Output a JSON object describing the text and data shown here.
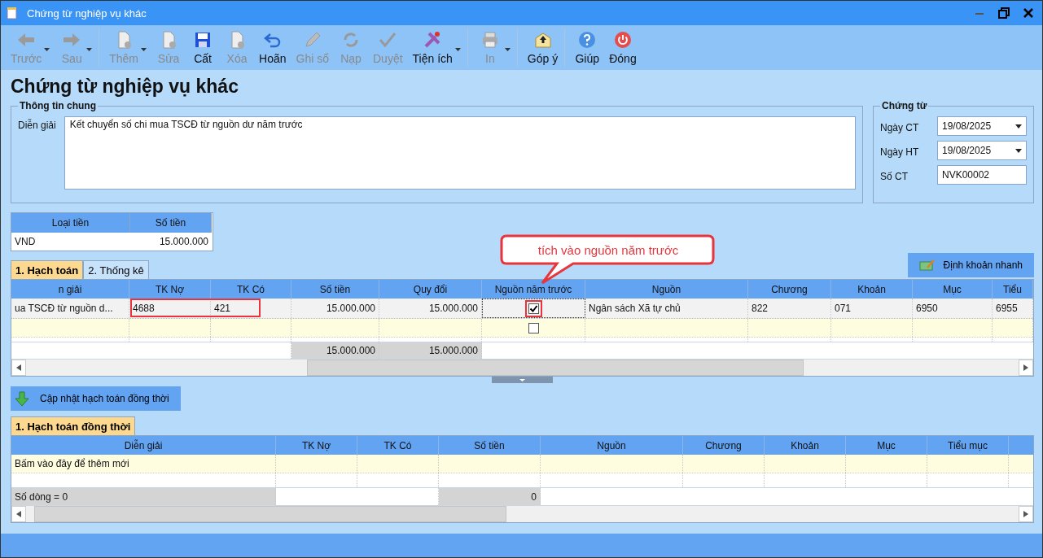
{
  "window": {
    "title": "Chứng từ nghiệp vụ khác"
  },
  "toolbar": [
    {
      "label": "Trước",
      "enabled": false,
      "dropdown": true,
      "sep_after": false
    },
    {
      "label": "Sau",
      "enabled": false,
      "dropdown": true,
      "sep_after": true
    },
    {
      "label": "Thêm",
      "enabled": false,
      "dropdown": true,
      "sep_after": false
    },
    {
      "label": "Sửa",
      "enabled": false,
      "dropdown": false,
      "sep_after": false
    },
    {
      "label": "Cất",
      "enabled": true,
      "dropdown": false,
      "sep_after": false
    },
    {
      "label": "Xóa",
      "enabled": false,
      "dropdown": false,
      "sep_after": false
    },
    {
      "label": "Hoãn",
      "enabled": true,
      "dropdown": false,
      "sep_after": false
    },
    {
      "label": "Ghi sổ",
      "enabled": false,
      "dropdown": false,
      "sep_after": false
    },
    {
      "label": "Nạp",
      "enabled": false,
      "dropdown": false,
      "sep_after": false
    },
    {
      "label": "Duyệt",
      "enabled": false,
      "dropdown": false,
      "sep_after": false
    },
    {
      "label": "Tiện ích",
      "enabled": true,
      "dropdown": true,
      "sep_after": true
    },
    {
      "label": "In",
      "enabled": false,
      "dropdown": true,
      "sep_after": true
    },
    {
      "label": "Góp ý",
      "enabled": true,
      "dropdown": false,
      "sep_after": true
    },
    {
      "label": "Giúp",
      "enabled": true,
      "dropdown": false,
      "sep_after": false
    },
    {
      "label": "Đóng",
      "enabled": true,
      "dropdown": false,
      "sep_after": false
    }
  ],
  "heading": "Chứng từ nghiệp vụ khác",
  "general": {
    "title": "Thông tin chung",
    "label": "Diễn giải",
    "value": "Kết chuyển số chi mua TSCĐ từ nguồn dư năm trước"
  },
  "voucher": {
    "title": "Chứng từ",
    "fields": [
      {
        "label": "Ngày CT",
        "value": "19/08/2025",
        "kind": "date"
      },
      {
        "label": "Ngày HT",
        "value": "19/08/2025",
        "kind": "date"
      },
      {
        "label": "Số CT",
        "value": "NVK00002",
        "kind": "text"
      }
    ]
  },
  "currency": {
    "columns": [
      "Loại tiền",
      "Số tiền"
    ],
    "row": [
      "VND",
      "15.000.000"
    ]
  },
  "tabs": [
    {
      "label": "1. Hạch toán",
      "selected": true
    },
    {
      "label": "2. Thống kê",
      "selected": false
    }
  ],
  "quick_button": "Định khoản nhanh",
  "callout": "tích vào nguồn năm trước",
  "grid": {
    "columns": [
      "n giải",
      "TK Nợ",
      "TK Có",
      "Số tiền",
      "Quy đổi",
      "Nguồn năm trước",
      "Nguồn",
      "Chương",
      "Khoản",
      "Mục",
      "Tiểu"
    ],
    "rows": [
      {
        "kind": "data",
        "cells": [
          "ua TSCĐ từ nguồn d...",
          "4688",
          "421",
          "15.000.000",
          "15.000.000",
          "Ngân sách Xã tự chủ",
          "822",
          "071",
          "6950",
          "6955"
        ],
        "checked": true,
        "highlighted": true
      },
      {
        "kind": "new",
        "checked": false
      }
    ],
    "totals": [
      "15.000.000",
      "15.000.000"
    ]
  },
  "sync_button": "Cập nhật hạch toán đồng thời",
  "sync_tab": {
    "label": "1. Hạch toán đồng thời",
    "selected": true
  },
  "grid2": {
    "columns": [
      "Diễn giải",
      "TK Nợ",
      "TK Có",
      "Số tiền",
      "Nguồn",
      "Chương",
      "Khoản",
      "Mục",
      "Tiểu mục"
    ],
    "new_row": "Bấm vào đây để thêm mới",
    "count": "Số dòng = 0",
    "total": "0"
  }
}
